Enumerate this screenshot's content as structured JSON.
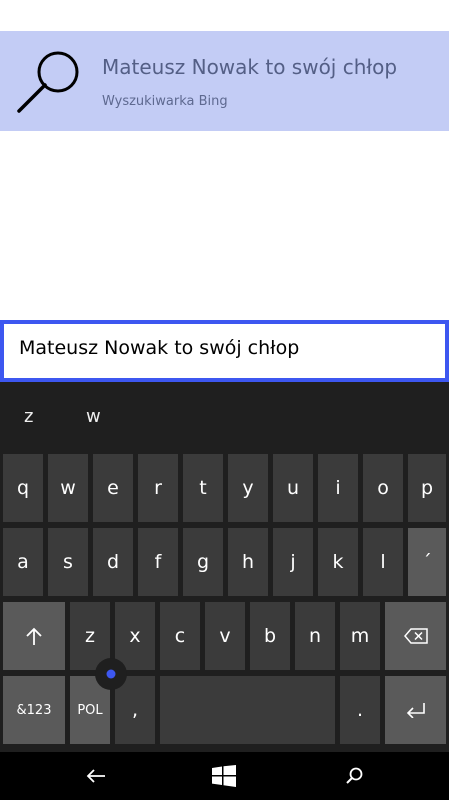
{
  "suggestion": {
    "title": "Mateusz Nowak to swój chłop",
    "subtitle": "Wyszukiwarka Bing"
  },
  "search": {
    "value": "Mateusz Nowak to swój chłop"
  },
  "keyboard": {
    "predictions": [
      "z",
      "w"
    ],
    "row1": [
      "q",
      "w",
      "e",
      "r",
      "t",
      "y",
      "u",
      "i",
      "o",
      "p"
    ],
    "row2": [
      "a",
      "s",
      "d",
      "f",
      "g",
      "h",
      "j",
      "k",
      "l",
      "´"
    ],
    "row3": [
      "z",
      "x",
      "c",
      "v",
      "b",
      "n",
      "m"
    ],
    "numbers_label": "&123",
    "language_label": "POL",
    "comma_label": ",",
    "period_label": "."
  },
  "colors": {
    "accent": "#3d57f0",
    "suggestion_bg": "#c3ccf5",
    "keyboard_bg": "#1f1f1f",
    "key_bg": "#3b3b3b",
    "key_light_bg": "#5a5a5a"
  },
  "icons": {
    "search": "magnifier-icon",
    "shift": "up-arrow-icon",
    "backspace": "backspace-icon",
    "enter": "enter-icon",
    "back": "back-arrow-icon",
    "start": "windows-logo-icon",
    "search_nav": "search-icon"
  }
}
